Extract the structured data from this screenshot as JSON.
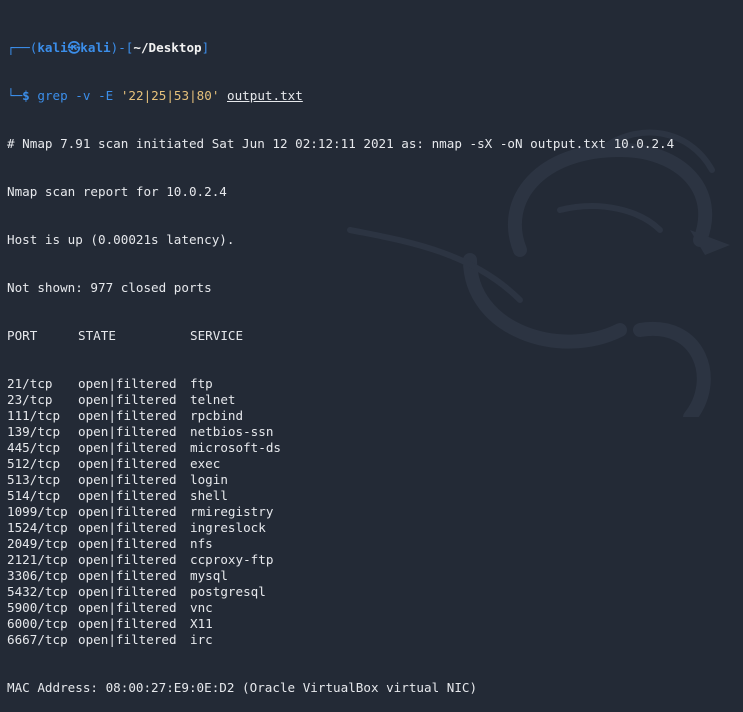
{
  "prompt": {
    "user": "kali",
    "at_symbol": "㉿",
    "host": "kali",
    "dir": "~/Desktop",
    "dollar": "$"
  },
  "command": {
    "name": "grep",
    "flag_v": "-v",
    "flag_e": "-E",
    "pattern": "'22|25|53|80'",
    "file": "output.txt"
  },
  "output": {
    "header_line": "# Nmap 7.91 scan initiated Sat Jun 12 02:12:11 2021 as: nmap -sX -oN output.txt 10.0.2.4",
    "report_line": "Nmap scan report for 10.0.2.4",
    "host_line": "Host is up (0.00021s latency).",
    "not_shown_line": "Not shown: 977 closed ports",
    "columns": [
      "PORT",
      "STATE",
      "SERVICE"
    ],
    "rows": [
      {
        "port": "21/tcp",
        "state": "open|filtered",
        "service": "ftp"
      },
      {
        "port": "23/tcp",
        "state": "open|filtered",
        "service": "telnet"
      },
      {
        "port": "111/tcp",
        "state": "open|filtered",
        "service": "rpcbind"
      },
      {
        "port": "139/tcp",
        "state": "open|filtered",
        "service": "netbios-ssn"
      },
      {
        "port": "445/tcp",
        "state": "open|filtered",
        "service": "microsoft-ds"
      },
      {
        "port": "512/tcp",
        "state": "open|filtered",
        "service": "exec"
      },
      {
        "port": "513/tcp",
        "state": "open|filtered",
        "service": "login"
      },
      {
        "port": "514/tcp",
        "state": "open|filtered",
        "service": "shell"
      },
      {
        "port": "1099/tcp",
        "state": "open|filtered",
        "service": "rmiregistry"
      },
      {
        "port": "1524/tcp",
        "state": "open|filtered",
        "service": "ingreslock"
      },
      {
        "port": "2049/tcp",
        "state": "open|filtered",
        "service": "nfs"
      },
      {
        "port": "2121/tcp",
        "state": "open|filtered",
        "service": "ccproxy-ftp"
      },
      {
        "port": "3306/tcp",
        "state": "open|filtered",
        "service": "mysql"
      },
      {
        "port": "5432/tcp",
        "state": "open|filtered",
        "service": "postgresql"
      },
      {
        "port": "5900/tcp",
        "state": "open|filtered",
        "service": "vnc"
      },
      {
        "port": "6000/tcp",
        "state": "open|filtered",
        "service": "X11"
      },
      {
        "port": "6667/tcp",
        "state": "open|filtered",
        "service": "irc"
      }
    ],
    "mac_line": "MAC Address: 08:00:27:E9:0E:D2 (Oracle VirtualBox virtual NIC)"
  },
  "colors": {
    "background": "#232a36",
    "prompt_blue": "#3b8eea",
    "pattern_yellow": "#e5c07b",
    "text": "#e6e8ec",
    "dragon": "#2c3442"
  },
  "icons": [
    "kali-dragon-watermark-icon"
  ]
}
